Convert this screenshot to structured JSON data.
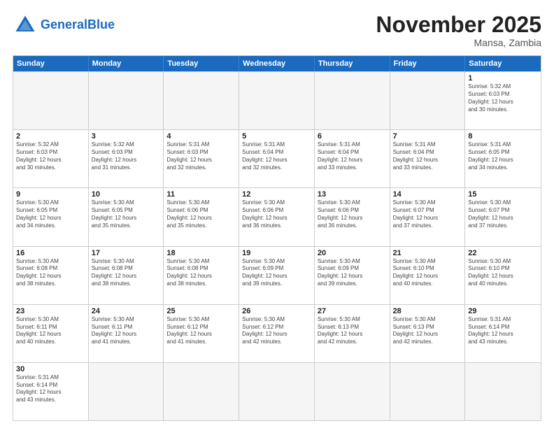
{
  "header": {
    "logo_general": "General",
    "logo_blue": "Blue",
    "month_title": "November 2025",
    "location": "Mansa, Zambia"
  },
  "weekdays": [
    "Sunday",
    "Monday",
    "Tuesday",
    "Wednesday",
    "Thursday",
    "Friday",
    "Saturday"
  ],
  "rows": [
    [
      {
        "day": "",
        "info": ""
      },
      {
        "day": "",
        "info": ""
      },
      {
        "day": "",
        "info": ""
      },
      {
        "day": "",
        "info": ""
      },
      {
        "day": "",
        "info": ""
      },
      {
        "day": "",
        "info": ""
      },
      {
        "day": "1",
        "info": "Sunrise: 5:32 AM\nSunset: 6:03 PM\nDaylight: 12 hours\nand 30 minutes."
      }
    ],
    [
      {
        "day": "2",
        "info": "Sunrise: 5:32 AM\nSunset: 6:03 PM\nDaylight: 12 hours\nand 30 minutes."
      },
      {
        "day": "3",
        "info": "Sunrise: 5:32 AM\nSunset: 6:03 PM\nDaylight: 12 hours\nand 31 minutes."
      },
      {
        "day": "4",
        "info": "Sunrise: 5:31 AM\nSunset: 6:03 PM\nDaylight: 12 hours\nand 32 minutes."
      },
      {
        "day": "5",
        "info": "Sunrise: 5:31 AM\nSunset: 6:04 PM\nDaylight: 12 hours\nand 32 minutes."
      },
      {
        "day": "6",
        "info": "Sunrise: 5:31 AM\nSunset: 6:04 PM\nDaylight: 12 hours\nand 33 minutes."
      },
      {
        "day": "7",
        "info": "Sunrise: 5:31 AM\nSunset: 6:04 PM\nDaylight: 12 hours\nand 33 minutes."
      },
      {
        "day": "8",
        "info": "Sunrise: 5:31 AM\nSunset: 6:05 PM\nDaylight: 12 hours\nand 34 minutes."
      }
    ],
    [
      {
        "day": "9",
        "info": "Sunrise: 5:30 AM\nSunset: 6:05 PM\nDaylight: 12 hours\nand 34 minutes."
      },
      {
        "day": "10",
        "info": "Sunrise: 5:30 AM\nSunset: 6:05 PM\nDaylight: 12 hours\nand 35 minutes."
      },
      {
        "day": "11",
        "info": "Sunrise: 5:30 AM\nSunset: 6:06 PM\nDaylight: 12 hours\nand 35 minutes."
      },
      {
        "day": "12",
        "info": "Sunrise: 5:30 AM\nSunset: 6:06 PM\nDaylight: 12 hours\nand 36 minutes."
      },
      {
        "day": "13",
        "info": "Sunrise: 5:30 AM\nSunset: 6:06 PM\nDaylight: 12 hours\nand 36 minutes."
      },
      {
        "day": "14",
        "info": "Sunrise: 5:30 AM\nSunset: 6:07 PM\nDaylight: 12 hours\nand 37 minutes."
      },
      {
        "day": "15",
        "info": "Sunrise: 5:30 AM\nSunset: 6:07 PM\nDaylight: 12 hours\nand 37 minutes."
      }
    ],
    [
      {
        "day": "16",
        "info": "Sunrise: 5:30 AM\nSunset: 6:08 PM\nDaylight: 12 hours\nand 38 minutes."
      },
      {
        "day": "17",
        "info": "Sunrise: 5:30 AM\nSunset: 6:08 PM\nDaylight: 12 hours\nand 38 minutes."
      },
      {
        "day": "18",
        "info": "Sunrise: 5:30 AM\nSunset: 6:08 PM\nDaylight: 12 hours\nand 38 minutes."
      },
      {
        "day": "19",
        "info": "Sunrise: 5:30 AM\nSunset: 6:09 PM\nDaylight: 12 hours\nand 39 minutes."
      },
      {
        "day": "20",
        "info": "Sunrise: 5:30 AM\nSunset: 6:09 PM\nDaylight: 12 hours\nand 39 minutes."
      },
      {
        "day": "21",
        "info": "Sunrise: 5:30 AM\nSunset: 6:10 PM\nDaylight: 12 hours\nand 40 minutes."
      },
      {
        "day": "22",
        "info": "Sunrise: 5:30 AM\nSunset: 6:10 PM\nDaylight: 12 hours\nand 40 minutes."
      }
    ],
    [
      {
        "day": "23",
        "info": "Sunrise: 5:30 AM\nSunset: 6:11 PM\nDaylight: 12 hours\nand 40 minutes."
      },
      {
        "day": "24",
        "info": "Sunrise: 5:30 AM\nSunset: 6:11 PM\nDaylight: 12 hours\nand 41 minutes."
      },
      {
        "day": "25",
        "info": "Sunrise: 5:30 AM\nSunset: 6:12 PM\nDaylight: 12 hours\nand 41 minutes."
      },
      {
        "day": "26",
        "info": "Sunrise: 5:30 AM\nSunset: 6:12 PM\nDaylight: 12 hours\nand 42 minutes."
      },
      {
        "day": "27",
        "info": "Sunrise: 5:30 AM\nSunset: 6:13 PM\nDaylight: 12 hours\nand 42 minutes."
      },
      {
        "day": "28",
        "info": "Sunrise: 5:30 AM\nSunset: 6:13 PM\nDaylight: 12 hours\nand 42 minutes."
      },
      {
        "day": "29",
        "info": "Sunrise: 5:31 AM\nSunset: 6:14 PM\nDaylight: 12 hours\nand 43 minutes."
      }
    ],
    [
      {
        "day": "30",
        "info": "Sunrise: 5:31 AM\nSunset: 6:14 PM\nDaylight: 12 hours\nand 43 minutes."
      },
      {
        "day": "",
        "info": ""
      },
      {
        "day": "",
        "info": ""
      },
      {
        "day": "",
        "info": ""
      },
      {
        "day": "",
        "info": ""
      },
      {
        "day": "",
        "info": ""
      },
      {
        "day": "",
        "info": ""
      }
    ]
  ]
}
